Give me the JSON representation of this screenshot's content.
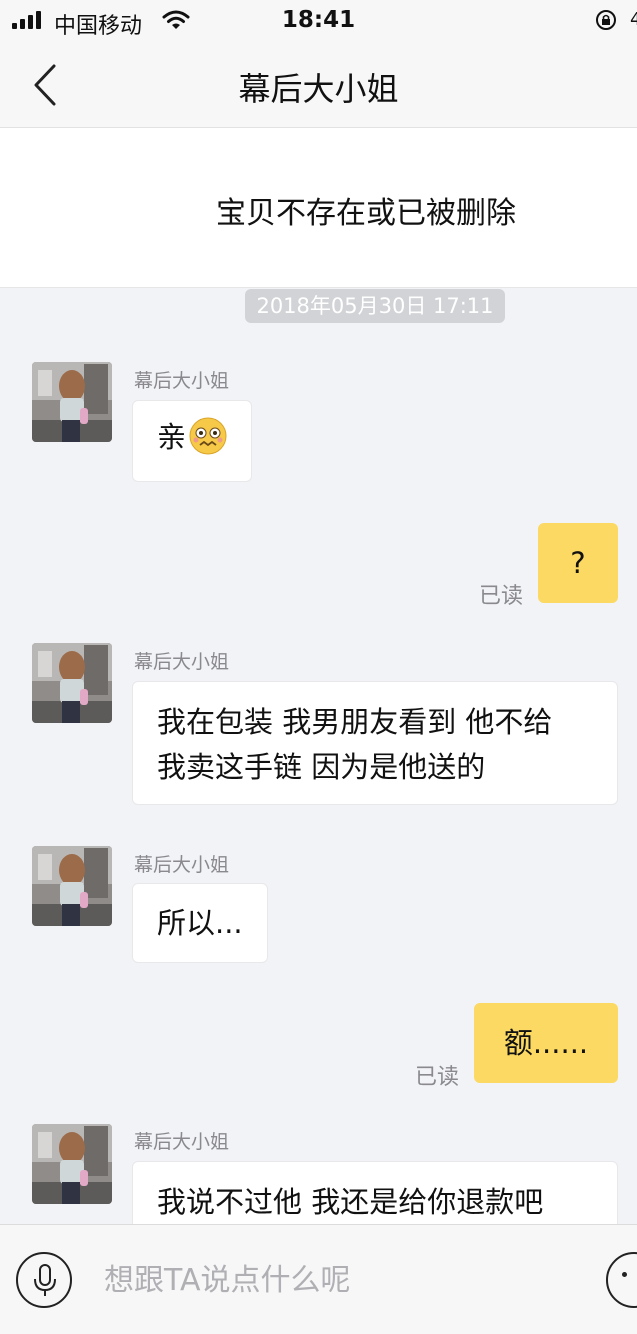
{
  "status_bar": {
    "carrier": "中国移动",
    "time": "18:41",
    "battery_peek": "4"
  },
  "header": {
    "title": "幕后大小姐",
    "back_icon": "chevron-left-icon"
  },
  "product_notice": "宝贝不存在或已被删除",
  "timestamp": "2018年05月30日 17:11",
  "colors": {
    "outgoing_bubble": "#fbd962",
    "background": "#f2f3f7",
    "timestamp_pill": "#d2d3d7"
  },
  "messages": [
    {
      "sender": "幕后大小姐",
      "text": "亲",
      "emoji": "worried-face-emoji"
    },
    {
      "text": "?",
      "read_label": "已读"
    },
    {
      "sender": "幕后大小姐",
      "lines": [
        "我在包装 我男朋友看到 他不给",
        "我卖这手链 因为是他送的"
      ]
    },
    {
      "sender": "幕后大小姐",
      "text": "所以..."
    },
    {
      "text": "额......",
      "read_label": "已读"
    },
    {
      "sender": "幕后大小姐",
      "text": "我说不过他 我还是给你退款吧"
    }
  ],
  "input_bar": {
    "placeholder": "想跟TA说点什么呢",
    "voice_icon": "microphone-icon",
    "emoji_icon": "smiley-icon"
  }
}
